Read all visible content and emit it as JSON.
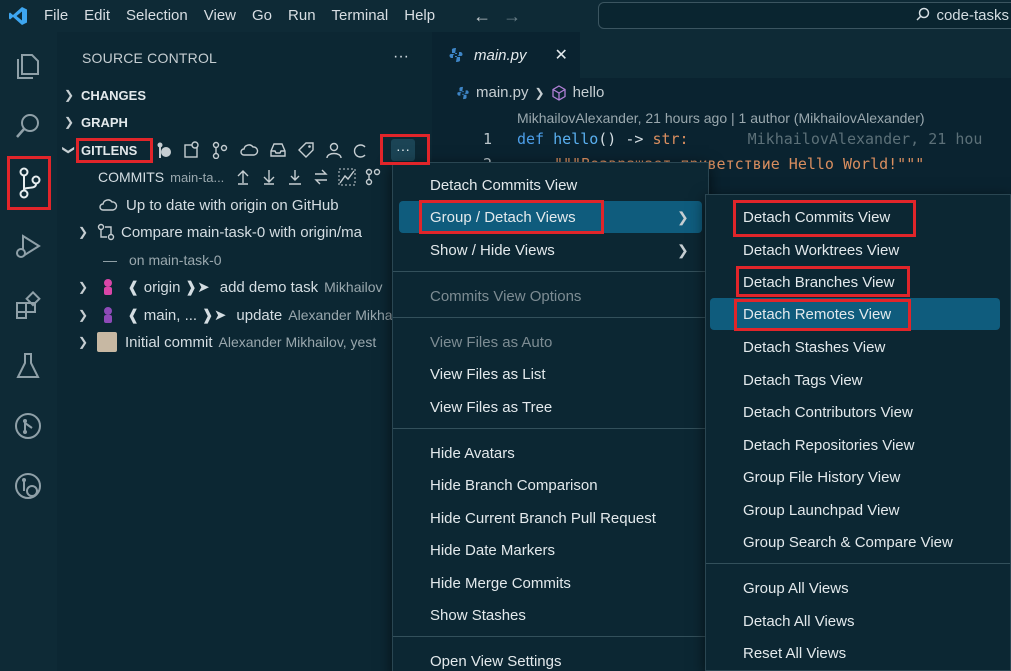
{
  "menubar": {
    "items": [
      "File",
      "Edit",
      "Selection",
      "View",
      "Go",
      "Run",
      "Terminal",
      "Help"
    ],
    "search_text": "code-tasks"
  },
  "sidebar": {
    "title": "SOURCE CONTROL",
    "sections": [
      "CHANGES",
      "GRAPH",
      "GITLENS"
    ],
    "commits_label": "COMMITS",
    "commits_branch": "main-ta...",
    "rows": {
      "uptodate": "Up to date with origin on GitHub",
      "compare": "Compare main-task-0 with origin/ma",
      "on_branch": "on main-task-0",
      "c1_tag": "❰ origin ❱➤",
      "c1_msg": "add demo task",
      "c1_author": "Mikhailov",
      "c2_tag": "❰ main, ... ❱➤",
      "c2_msg": "update",
      "c2_author": "Alexander Mikha",
      "c3_msg": "Initial commit",
      "c3_author": "Alexander Mikhailov, yest"
    }
  },
  "editor": {
    "tab_label": "main.py",
    "crumb_file": "main.py",
    "crumb_symbol": "hello",
    "blame_header": "MikhailovAlexander, 21 hours ago | 1 author (MikhailovAlexander)",
    "line1_num": "1",
    "line1_def": "def",
    "line1_name": "hello",
    "line1_rest": "() ->",
    "line1_type": "str:",
    "line1_blame": "MikhailovAlexander, 21 hou",
    "line2_num": "2",
    "line2_text": "\"\"\"Возвращает приветствие Hello World!\"\"\""
  },
  "context_menu": {
    "items": [
      "Detach Commits View",
      "Group / Detach Views",
      "Show / Hide Views",
      "Commits View Options",
      "View Files as Auto",
      "View Files as List",
      "View Files as Tree",
      "Hide Avatars",
      "Hide Branch Comparison",
      "Hide Current Branch Pull Request",
      "Hide Date Markers",
      "Hide Merge Commits",
      "Show Stashes",
      "Open View Settings"
    ]
  },
  "submenu": {
    "items": [
      "Detach Commits View",
      "Detach Worktrees View",
      "Detach Branches View",
      "Detach Remotes View",
      "Detach Stashes View",
      "Detach Tags View",
      "Detach Contributors View",
      "Detach Repositories View",
      "Group File History View",
      "Group Launchpad View",
      "Group Search & Compare View",
      "Group All Views",
      "Detach All Views",
      "Reset All Views"
    ]
  },
  "colors": {
    "accent_red": "#e1252a",
    "selection": "#0f5c7d",
    "background": "#0e2a36"
  }
}
